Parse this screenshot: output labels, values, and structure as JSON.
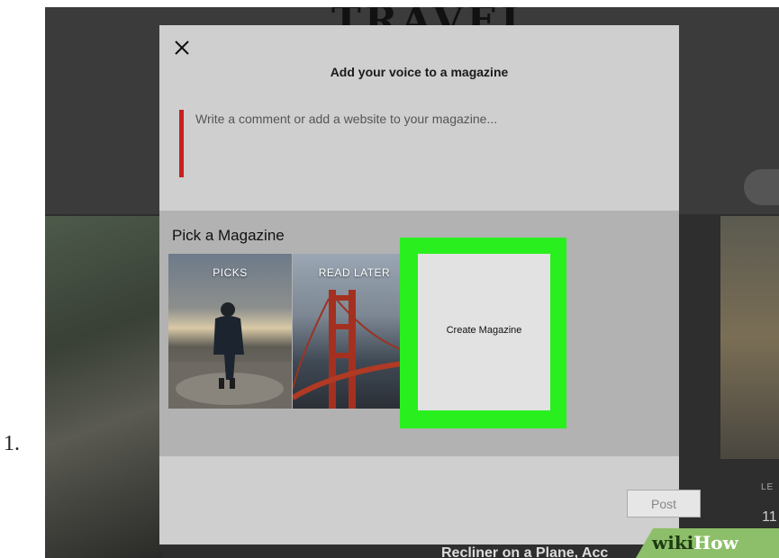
{
  "list_number": "1.",
  "background": {
    "title_partial": "TRAVEL",
    "bottom_text": "Recliner on a Plane, Acc",
    "side_label": "LE",
    "side_number": "11"
  },
  "dialog": {
    "close_glyph": "✕",
    "title": "Add your voice to a magazine",
    "comment_placeholder": "Write a comment or add a website to your magazine...",
    "pick_title": "Pick a Magazine",
    "magazines": [
      {
        "label": "PICKS"
      },
      {
        "label": "READ LATER"
      }
    ],
    "create_label": "Create Magazine",
    "post_label": "Post"
  },
  "colors": {
    "accent_red": "#c8201d",
    "highlight_green": "#29ef1f"
  },
  "watermark": {
    "wiki": "wiki",
    "how": "How"
  }
}
